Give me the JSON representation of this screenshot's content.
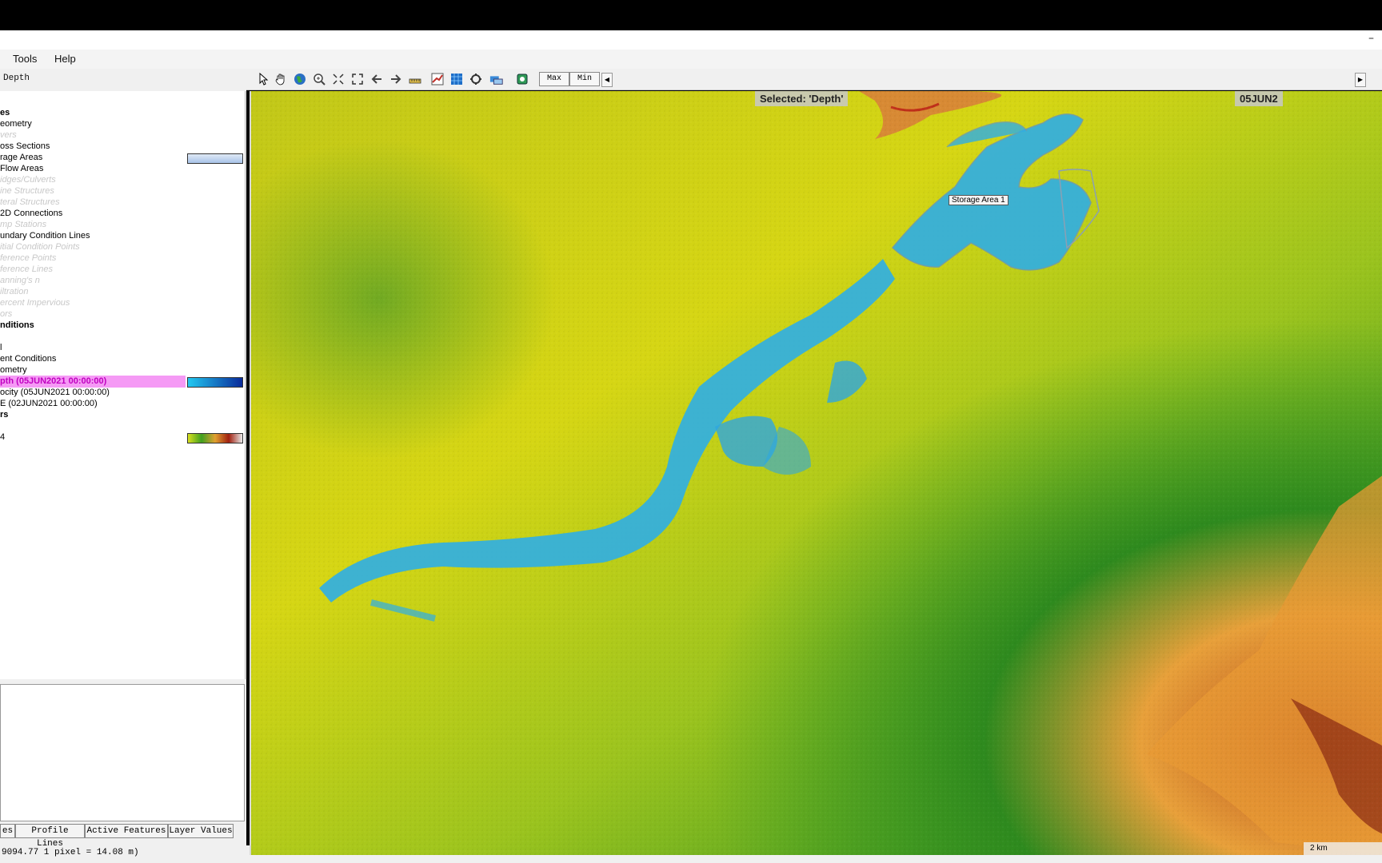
{
  "menu": {
    "tools": "Tools",
    "help": "Help"
  },
  "toolbar": {
    "layer_tab": "Depth",
    "max_label": "Max",
    "min_label": "Min"
  },
  "layers": [
    {
      "label": "es",
      "style": "bold"
    },
    {
      "label": "eometry",
      "style": "normal"
    },
    {
      "label": "vers",
      "style": "dim"
    },
    {
      "label": "oss Sections",
      "style": "normal"
    },
    {
      "label": "rage Areas",
      "style": "normal"
    },
    {
      "label": "Flow Areas",
      "style": "normal"
    },
    {
      "label": "idges/Culverts",
      "style": "dim"
    },
    {
      "label": "ine Structures",
      "style": "dim"
    },
    {
      "label": "teral Structures",
      "style": "dim"
    },
    {
      "label": "2D Connections",
      "style": "normal"
    },
    {
      "label": "mp Stations",
      "style": "dim"
    },
    {
      "label": "undary Condition Lines",
      "style": "normal"
    },
    {
      "label": "itial Condition Points",
      "style": "dim"
    },
    {
      "label": "ference Points",
      "style": "dim"
    },
    {
      "label": "ference Lines",
      "style": "dim"
    },
    {
      "label": "anning's n",
      "style": "dim"
    },
    {
      "label": "iltration",
      "style": "dim"
    },
    {
      "label": "ercent Impervious",
      "style": "dim"
    },
    {
      "label": "ors",
      "style": "dim"
    },
    {
      "label": "nditions",
      "style": "bold"
    },
    {
      "label": "",
      "style": "normal"
    },
    {
      "label": "l",
      "style": "normal"
    },
    {
      "label": "ent Conditions",
      "style": "normal"
    },
    {
      "label": "ometry",
      "style": "normal"
    },
    {
      "label": "pth (05JUN2021 00:00:00)",
      "style": "sel"
    },
    {
      "label": "ocity (05JUN2021 00:00:00)",
      "style": "normal"
    },
    {
      "label": "E (02JUN2021 00:00:00)",
      "style": "normal"
    },
    {
      "label": "rs",
      "style": "bold"
    },
    {
      "label": "",
      "style": "normal"
    },
    {
      "label": "4",
      "style": "normal"
    }
  ],
  "bottom_tabs": [
    "es",
    "Profile Lines",
    "Active Features",
    "Layer Values"
  ],
  "status": {
    "text": "9094.77  1 pixel = 14.08 m)"
  },
  "map": {
    "selected_label": "Selected: 'Depth'",
    "date_label": "05JUN2",
    "storage_label": "Storage Area 1",
    "scale_label": "2 km"
  },
  "colors": {
    "terrain_low": "#d8d818",
    "terrain_mid": "#4a9a28",
    "terrain_high": "#c87a1e",
    "water": "#2eaee6",
    "selection": "#f59af5"
  }
}
